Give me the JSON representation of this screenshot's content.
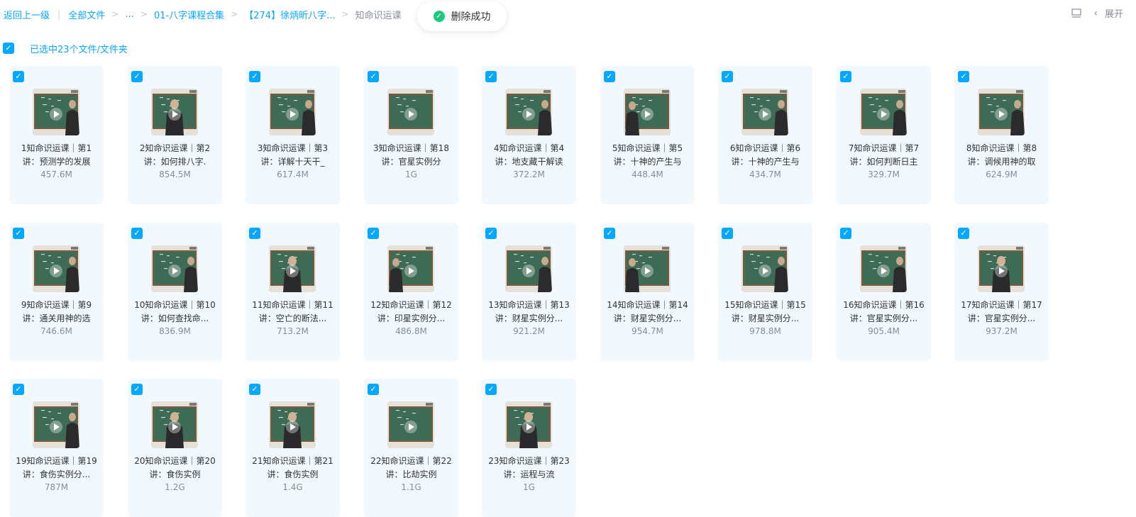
{
  "breadcrumb": {
    "back": "返回上一级",
    "all_files": "全部文件",
    "ellipsis": "...",
    "folder1": "01-八字课程合集",
    "folder2": "【274】徐炳昕八字...",
    "current": "知命识运课"
  },
  "toast": {
    "text": "删除成功",
    "icon": "check-circle-icon"
  },
  "top_right": {
    "expand_label": "展开",
    "view_icon": "list-view-icon",
    "chevron_icon": "chevron-left-icon"
  },
  "selection": {
    "text": "已选中23个文件/文件夹",
    "checked": true
  },
  "colors": {
    "accent": "#06a7ff",
    "card_bg": "#f1f8fe",
    "success": "#1bc97a",
    "muted": "#878c9c"
  },
  "files": [
    {
      "name": "1知命识运课｜第1讲：预测学的发展",
      "size": "457.6M",
      "selected": true,
      "icon": "video-thumbnail"
    },
    {
      "name": "2知命识运课｜第2讲：如何排八字.",
      "size": "854.5M",
      "selected": true,
      "icon": "video-thumbnail"
    },
    {
      "name": "3知命识运课｜第3讲：详解十天干_",
      "size": "617.4M",
      "selected": true,
      "icon": "video-thumbnail"
    },
    {
      "name": "3知命识运课｜第18讲：官星实例分",
      "size": "1G",
      "selected": true,
      "icon": "video-thumbnail"
    },
    {
      "name": "4知命识运课｜第4讲：地支藏干解读",
      "size": "372.2M",
      "selected": true,
      "icon": "video-thumbnail"
    },
    {
      "name": "5知命识运课｜第5讲：十神的产生与",
      "size": "448.4M",
      "selected": true,
      "icon": "video-thumbnail"
    },
    {
      "name": "6知命识运课｜第6讲：十神的产生与",
      "size": "434.7M",
      "selected": true,
      "icon": "video-thumbnail"
    },
    {
      "name": "7知命识运课｜第7讲：如何判断日主",
      "size": "329.7M",
      "selected": true,
      "icon": "video-thumbnail"
    },
    {
      "name": "8知命识运课｜第8讲：调候用神的取",
      "size": "624.9M",
      "selected": true,
      "icon": "video-thumbnail"
    },
    {
      "name": "9知命识运课｜第9讲：通关用神的选",
      "size": "746.6M",
      "selected": true,
      "icon": "video-thumbnail"
    },
    {
      "name": "10知命识运课｜第10讲：如何查找命...",
      "size": "836.9M",
      "selected": true,
      "icon": "video-thumbnail"
    },
    {
      "name": "11知命识运课｜第11讲：空亡的断法...",
      "size": "713.2M",
      "selected": true,
      "icon": "video-thumbnail"
    },
    {
      "name": "12知命识运课｜第12讲：印星实例分...",
      "size": "486.8M",
      "selected": true,
      "icon": "video-thumbnail"
    },
    {
      "name": "13知命识运课｜第13讲：财星实例分...",
      "size": "921.2M",
      "selected": true,
      "icon": "video-thumbnail"
    },
    {
      "name": "14知命识运课｜第14讲：财星实例分...",
      "size": "954.7M",
      "selected": true,
      "icon": "video-thumbnail"
    },
    {
      "name": "15知命识运课｜第15讲：财星实例分...",
      "size": "978.8M",
      "selected": true,
      "icon": "video-thumbnail"
    },
    {
      "name": "16知命识运课｜第16讲：官星实例分...",
      "size": "905.4M",
      "selected": true,
      "icon": "video-thumbnail"
    },
    {
      "name": "17知命识运课｜第17讲：官星实例分...",
      "size": "937.2M",
      "selected": true,
      "icon": "video-thumbnail"
    },
    {
      "name": "19知命识运课｜第19讲：食伤实例分...",
      "size": "787M",
      "selected": true,
      "icon": "video-thumbnail"
    },
    {
      "name": "20知命识运课｜第20讲：食伤实例",
      "size": "1.2G",
      "selected": true,
      "icon": "video-thumbnail"
    },
    {
      "name": "21知命识运课｜第21讲：食伤实例",
      "size": "1.4G",
      "selected": true,
      "icon": "video-thumbnail"
    },
    {
      "name": "22知命识运课｜第22讲：比劫实例",
      "size": "1.1G",
      "selected": true,
      "icon": "video-thumbnail"
    },
    {
      "name": "23知命识运课｜第23讲：运程与流",
      "size": "1G",
      "selected": true,
      "icon": "video-thumbnail"
    }
  ]
}
